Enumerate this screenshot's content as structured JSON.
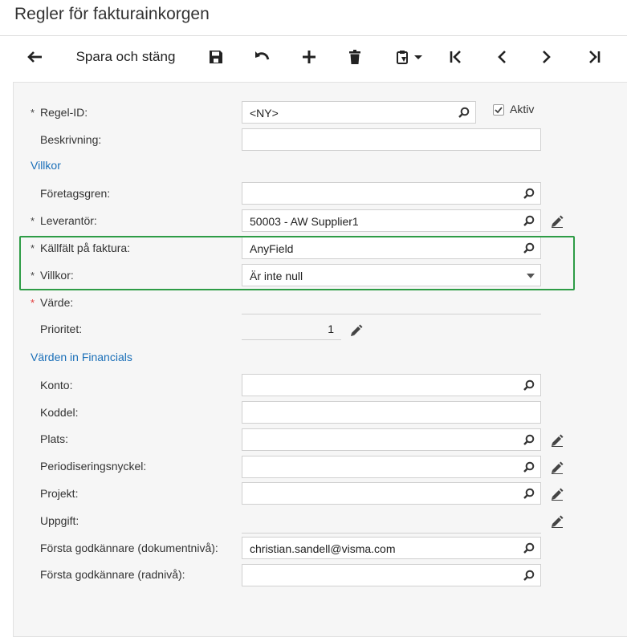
{
  "page_title": "Regler för fakturainkorgen",
  "toolbar": {
    "back_icon": "arrow-left-icon",
    "save_close_label": "Spara och stäng",
    "icons": [
      "save-icon",
      "undo-icon",
      "add-icon",
      "delete-icon",
      "clipboard-icon",
      "first-icon",
      "previous-icon",
      "next-icon",
      "last-icon"
    ]
  },
  "form": {
    "regel_id": {
      "label": "Regel-ID:",
      "value": "<NY>"
    },
    "aktiv": {
      "label": "Aktiv",
      "checked": true
    },
    "beskrivning": {
      "label": "Beskrivning:",
      "value": ""
    },
    "villkor_section": "Villkor",
    "foretagsgren": {
      "label": "Företagsgren:",
      "value": ""
    },
    "leverantor": {
      "label": "Leverantör:",
      "value": "50003 - AW Supplier1"
    },
    "kallfalt": {
      "label": "Källfält på faktura:",
      "value": "AnyField"
    },
    "villkor": {
      "label": "Villkor:",
      "value": "Är inte null"
    },
    "varde": {
      "label": "Värde:",
      "value": ""
    },
    "prioritet": {
      "label": "Prioritet:",
      "value": "1"
    },
    "financials_section": "Värden in Financials",
    "konto": {
      "label": "Konto:",
      "value": ""
    },
    "koddel": {
      "label": "Koddel:",
      "value": ""
    },
    "plats": {
      "label": "Plats:",
      "value": ""
    },
    "periodisering": {
      "label": "Periodiseringsnyckel:",
      "value": ""
    },
    "projekt": {
      "label": "Projekt:",
      "value": ""
    },
    "uppgift": {
      "label": "Uppgift:",
      "value": ""
    },
    "forsta_dok": {
      "label": "Första godkännare (dokumentnivå):",
      "value": "christian.sandell@visma.com"
    },
    "forsta_rad": {
      "label": "Första godkännare (radnivå):",
      "value": ""
    }
  },
  "colors": {
    "section_blue": "#1a6fb8",
    "highlight_green": "#2e9c46",
    "required_red": "#e23b3b"
  }
}
